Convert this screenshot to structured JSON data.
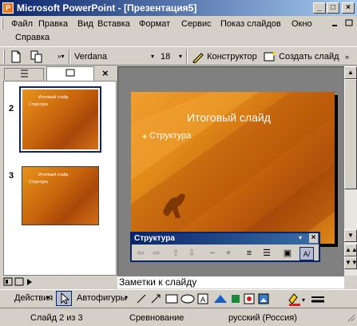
{
  "window": {
    "title": "Microsoft PowerPoint - [Презентация5]",
    "app_icon": "P"
  },
  "menu": {
    "items": [
      "Файл",
      "Правка",
      "Вид",
      "Вставка",
      "Формат",
      "Сервис",
      "Показ слайдов",
      "Окно"
    ],
    "second_row": [
      "Справка"
    ]
  },
  "toolbar": {
    "font_name": "Verdana",
    "font_size": "18",
    "designer_label": "Конструктор",
    "new_slide_label": "Создать слайд"
  },
  "slides_pane": {
    "slides": [
      {
        "number": "2",
        "title": "Итоговый слайд",
        "bullet": "Структура"
      },
      {
        "number": "3",
        "title": "Итоговый слайд",
        "bullet": "Структура"
      }
    ]
  },
  "slide": {
    "title": "Итоговый слайд",
    "bullet": "Структура"
  },
  "outline_toolbar": {
    "title": "Структура"
  },
  "notes": {
    "placeholder": "Заметки к слайду"
  },
  "drawing": {
    "actions_label": "Действия",
    "autoshapes_label": "Автофигуры"
  },
  "status": {
    "slide_info": "Слайд 2 из 3",
    "design": "Сревнование",
    "language": "русский (Россия)"
  },
  "colors": {
    "title_bar": "#0a246a",
    "slide_orange": "#e08818",
    "slide_dark": "#b0500a"
  }
}
